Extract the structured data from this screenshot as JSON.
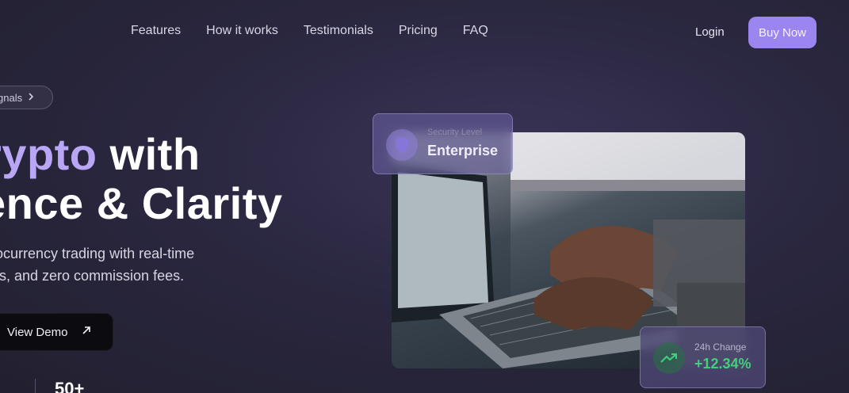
{
  "nav": {
    "links": [
      "Features",
      "How it works",
      "Testimonials",
      "Pricing",
      "FAQ"
    ],
    "login_label": "Login",
    "buy_label": "Buy Now"
  },
  "hero": {
    "badge_text": "gnals",
    "headline_accent": "rypto",
    "headline_line1_rest": " with",
    "headline_line2": "ence & Clarity",
    "subtitle_line1": "ocurrency trading with real-time",
    "subtitle_line2": "ts, and zero commission fees.",
    "demo_button_label": "View Demo",
    "stat_value": "50+"
  },
  "cards": {
    "security_label": "Security Level",
    "security_value": "Enterprise",
    "change_label": "24h Change",
    "change_value": "+12.34%"
  },
  "icons": {
    "badge_chevron": "chevron-right-icon",
    "demo_arrow": "arrow-up-right-icon",
    "security": "shield-icon",
    "change": "trending-up-icon"
  },
  "colors": {
    "accent": "#9b85ee",
    "headline_accent": "#b9a6f5",
    "positive": "#3fd27a"
  }
}
